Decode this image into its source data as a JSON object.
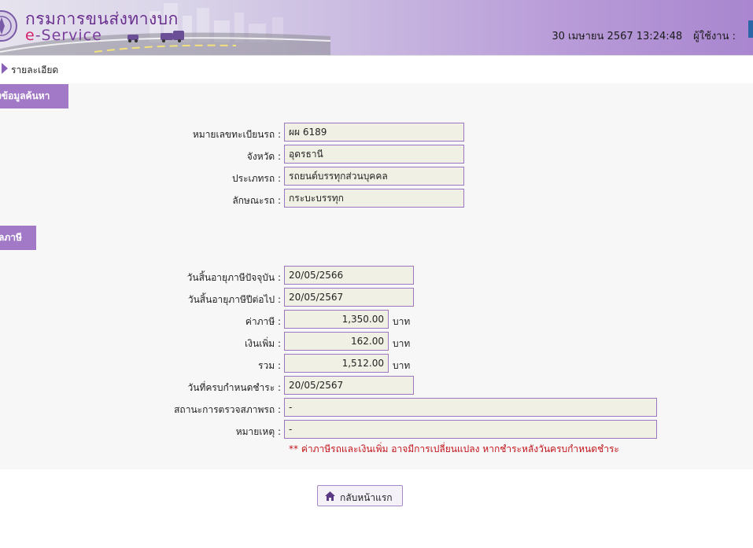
{
  "header": {
    "brand_thai": "กรมการขนส่งทางบก",
    "brand_e": "e",
    "brand_service": "-Service",
    "datetime": "30 เมษายน 2567 13:24:48",
    "user_label": "ผู้ใช้งาน :"
  },
  "breadcrumb": {
    "label": "รายละเอียด"
  },
  "sections": {
    "search": "งข้อมูลค้นหา",
    "tax": "ลภาษี"
  },
  "vehicle": {
    "plate_label": "หมายเลขทะเบียนรถ :",
    "plate_value": "ผผ 6189",
    "province_label": "จังหวัด :",
    "province_value": "อุดรธานี",
    "type_label": "ประเภทรถ :",
    "type_value": "รถยนต์บรรทุกส่วนบุคคล",
    "body_label": "ลักษณะรถ :",
    "body_value": "กระบะบรรทุก"
  },
  "tax": {
    "current_expiry_label": "วันสิ้นอายุภาษีปัจจุบัน :",
    "current_expiry_value": "20/05/2566",
    "next_expiry_label": "วันสิ้นอายุภาษีปีต่อไป :",
    "next_expiry_value": "20/05/2567",
    "tax_label": "ค่าภาษี :",
    "tax_value": "1,350.00",
    "surcharge_label": "เงินเพิ่ม :",
    "surcharge_value": "162.00",
    "total_label": "รวม :",
    "total_value": "1,512.00",
    "currency": "บาท",
    "due_label": "วันที่ครบกำหนดชำระ :",
    "due_value": "20/05/2567",
    "inspection_label": "สถานะการตรวจสภาพรถ :",
    "inspection_value": "-",
    "remark_label": "หมายเหตุ :",
    "remark_value": "-",
    "note": "** ค่าภาษีรถและเงินเพิ่ม อาจมีการเปลี่ยนแปลง หากชำระหลังวันครบกำหนดชำระ"
  },
  "actions": {
    "home_label": "กลับหน้าแรก"
  },
  "colors": {
    "accent": "#a279c7",
    "field_bg": "#f1f0e4",
    "field_border": "#9b76c2",
    "note": "#c3151c"
  },
  "icons": {
    "seal": "department-seal-icon",
    "breadcrumb": "triangle-right-icon",
    "home": "home-icon"
  }
}
